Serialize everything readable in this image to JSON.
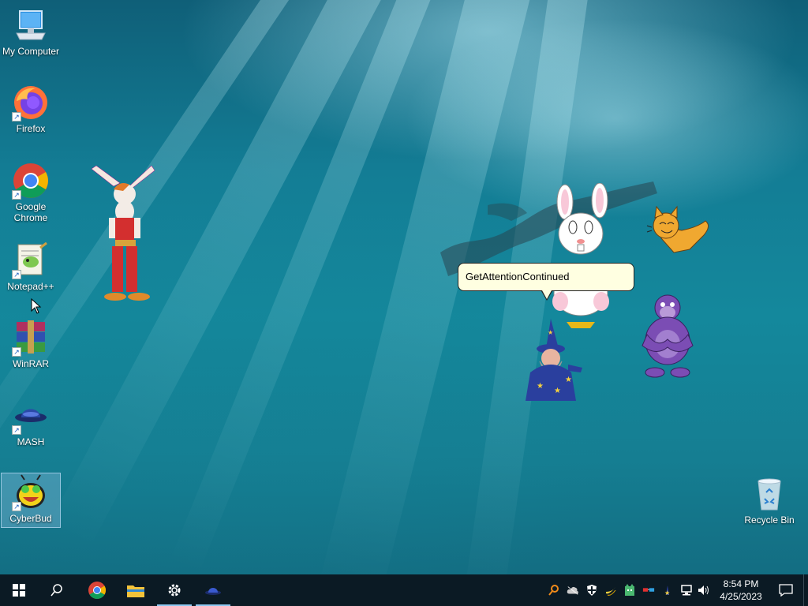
{
  "desktop": {
    "icons": [
      {
        "label": "My Computer",
        "icon": "computer-icon"
      },
      {
        "label": "Firefox",
        "icon": "firefox-icon"
      },
      {
        "label": "Google Chrome",
        "icon": "chrome-icon"
      },
      {
        "label": "Notepad++",
        "icon": "notepadpp-icon"
      },
      {
        "label": "WinRAR",
        "icon": "winrar-icon"
      },
      {
        "label": "MASH",
        "icon": "mash-icon"
      },
      {
        "label": "CyberBud",
        "icon": "cyberbud-icon"
      },
      {
        "label": "Recycle Bin",
        "icon": "recycle-bin-icon"
      }
    ],
    "agents": [
      "rabbit-agent",
      "white-bunny-agent",
      "cat-agent",
      "wizard-agent",
      "gorilla-agent"
    ],
    "balloon": {
      "text": "GetAttentionContinued"
    }
  },
  "taskbar": {
    "buttons": [
      "start-icon",
      "search-icon",
      "chrome-icon",
      "file-explorer-icon",
      "settings-icon",
      "mash-icon"
    ],
    "tray": [
      "search-magnifier-icon",
      "cloud-icon",
      "shield-icon",
      "banana-icon",
      "cat-tray-icon",
      "glasses-icon",
      "network-icon",
      "volume-icon"
    ],
    "clock": {
      "time": "8:54 PM",
      "date": "4/25/2023"
    },
    "notification": "action-center-icon"
  },
  "colors": {
    "taskbar": "#0b1a24",
    "water": "#14889c",
    "balloon": "#ffffe1"
  }
}
